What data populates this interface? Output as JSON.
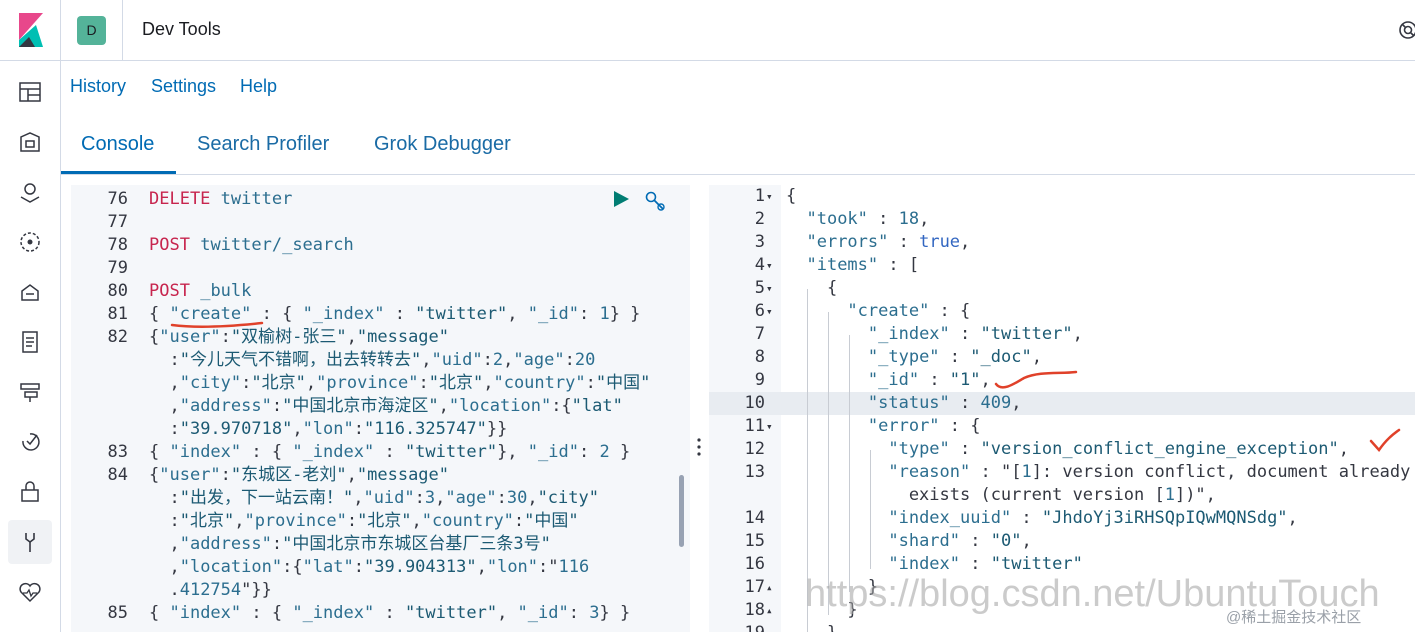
{
  "header": {
    "space_initial": "D",
    "app_title": "Dev Tools"
  },
  "subnav": {
    "links": [
      "History",
      "Settings",
      "Help"
    ]
  },
  "tabs": [
    {
      "label": "Console",
      "selected": true
    },
    {
      "label": "Search Profiler",
      "selected": false
    },
    {
      "label": "Grok Debugger",
      "selected": false
    }
  ],
  "request_editor": {
    "lines": [
      {
        "n": "76",
        "text": "DELETE twitter"
      },
      {
        "n": "77",
        "text": ""
      },
      {
        "n": "78",
        "text": "POST twitter/_search"
      },
      {
        "n": "79",
        "text": ""
      },
      {
        "n": "80",
        "text": "POST _bulk"
      },
      {
        "n": "81",
        "text": "{ \"create\" : { \"_index\" : \"twitter\", \"_id\": 1} }"
      },
      {
        "n": "82",
        "text": "{\"user\":\"双榆树-张三\",\"message\""
      },
      {
        "n": "",
        "text": "  :\"今儿天气不错啊，出去转转去\",\"uid\":2,\"age\":20"
      },
      {
        "n": "",
        "text": "  ,\"city\":\"北京\",\"province\":\"北京\",\"country\":\"中国\""
      },
      {
        "n": "",
        "text": "  ,\"address\":\"中国北京市海淀区\",\"location\":{\"lat\""
      },
      {
        "n": "",
        "text": "  :\"39.970718\",\"lon\":\"116.325747\"}}"
      },
      {
        "n": "83",
        "text": "{ \"index\" : { \"_index\" : \"twitter\"}, \"_id\": 2 }"
      },
      {
        "n": "84",
        "text": "{\"user\":\"东城区-老刘\",\"message\""
      },
      {
        "n": "",
        "text": "  :\"出发，下一站云南！\",\"uid\":3,\"age\":30,\"city\""
      },
      {
        "n": "",
        "text": "  :\"北京\",\"province\":\"北京\",\"country\":\"中国\""
      },
      {
        "n": "",
        "text": "  ,\"address\":\"中国北京市东城区台基厂三条3号\""
      },
      {
        "n": "",
        "text": "  ,\"location\":{\"lat\":\"39.904313\",\"lon\":\"116"
      },
      {
        "n": "",
        "text": "  .412754\"}}"
      },
      {
        "n": "85",
        "text": "{ \"index\" : { \"_index\" : \"twitter\", \"_id\": 3} }"
      }
    ]
  },
  "response_viewer": {
    "highlighted_line": "10",
    "lines": [
      {
        "n": "1",
        "fold": "▾",
        "text": "{"
      },
      {
        "n": "2",
        "fold": "",
        "text": "  \"took\" : 18,"
      },
      {
        "n": "3",
        "fold": "",
        "text": "  \"errors\" : true,"
      },
      {
        "n": "4",
        "fold": "▾",
        "text": "  \"items\" : ["
      },
      {
        "n": "5",
        "fold": "▾",
        "text": "    {"
      },
      {
        "n": "6",
        "fold": "▾",
        "text": "      \"create\" : {"
      },
      {
        "n": "7",
        "fold": "",
        "text": "        \"_index\" : \"twitter\","
      },
      {
        "n": "8",
        "fold": "",
        "text": "        \"_type\" : \"_doc\","
      },
      {
        "n": "9",
        "fold": "",
        "text": "        \"_id\" : \"1\","
      },
      {
        "n": "10",
        "fold": "",
        "text": "        \"status\" : 409,"
      },
      {
        "n": "11",
        "fold": "▾",
        "text": "        \"error\" : {"
      },
      {
        "n": "12",
        "fold": "",
        "text": "          \"type\" : \"version_conflict_engine_exception\","
      },
      {
        "n": "13",
        "fold": "",
        "text": "          \"reason\" : \"[1]: version conflict, document already"
      },
      {
        "n": "",
        "fold": "",
        "text": "            exists (current version [1])\","
      },
      {
        "n": "14",
        "fold": "",
        "text": "          \"index_uuid\" : \"JhdoYj3iRHSQpIQwMQNSdg\","
      },
      {
        "n": "15",
        "fold": "",
        "text": "          \"shard\" : \"0\","
      },
      {
        "n": "16",
        "fold": "",
        "text": "          \"index\" : \"twitter\""
      },
      {
        "n": "17",
        "fold": "▴",
        "text": "        }"
      },
      {
        "n": "18",
        "fold": "▴",
        "text": "      }"
      },
      {
        "n": "19",
        "fold": "",
        "text": "    },"
      }
    ]
  },
  "watermarks": {
    "main": "https://blog.csdn.net/UbuntuTouch",
    "corner": "@稀土掘金技术社区"
  },
  "colors": {
    "accent": "#006bb4",
    "annotation": "#e0412a",
    "avatar": "#54b399"
  }
}
